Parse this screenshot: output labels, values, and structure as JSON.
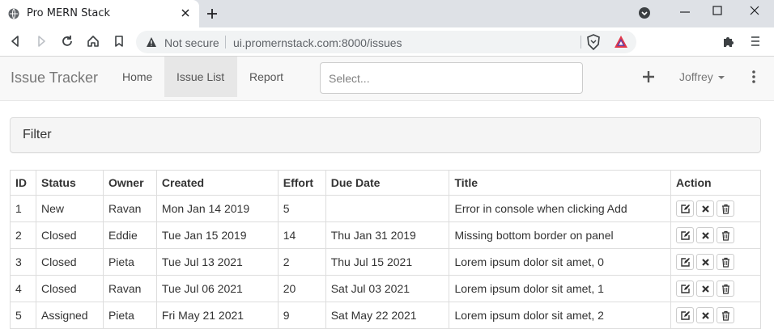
{
  "browser": {
    "tab_title": "Pro MERN Stack",
    "security_label": "Not secure",
    "url": "ui.promernstack.com:8000/issues"
  },
  "navbar": {
    "brand": "Issue Tracker",
    "links": [
      "Home",
      "Issue List",
      "Report"
    ],
    "active_link": "Issue List",
    "search_placeholder": "Select...",
    "user": "Joffrey"
  },
  "filter": {
    "title": "Filter"
  },
  "table": {
    "headers": [
      "ID",
      "Status",
      "Owner",
      "Created",
      "Effort",
      "Due Date",
      "Title",
      "Action"
    ],
    "rows": [
      [
        "1",
        "New",
        "Ravan",
        "Mon Jan 14 2019",
        "5",
        "",
        "Error in console when clicking Add"
      ],
      [
        "2",
        "Closed",
        "Eddie",
        "Tue Jan 15 2019",
        "14",
        "Thu Jan 31 2019",
        "Missing bottom border on panel"
      ],
      [
        "3",
        "Closed",
        "Pieta",
        "Tue Jul 13 2021",
        "2",
        "Thu Jul 15 2021",
        "Lorem ipsum dolor sit amet, 0"
      ],
      [
        "4",
        "Closed",
        "Ravan",
        "Tue Jul 06 2021",
        "20",
        "Sat Jul 03 2021",
        "Lorem ipsum dolor sit amet, 1"
      ],
      [
        "5",
        "Assigned",
        "Pieta",
        "Fri May 21 2021",
        "9",
        "Sat May 22 2021",
        "Lorem ipsum dolor sit amet, 2"
      ]
    ],
    "action_icons": [
      "edit-icon",
      "close-icon",
      "trash-icon"
    ]
  }
}
